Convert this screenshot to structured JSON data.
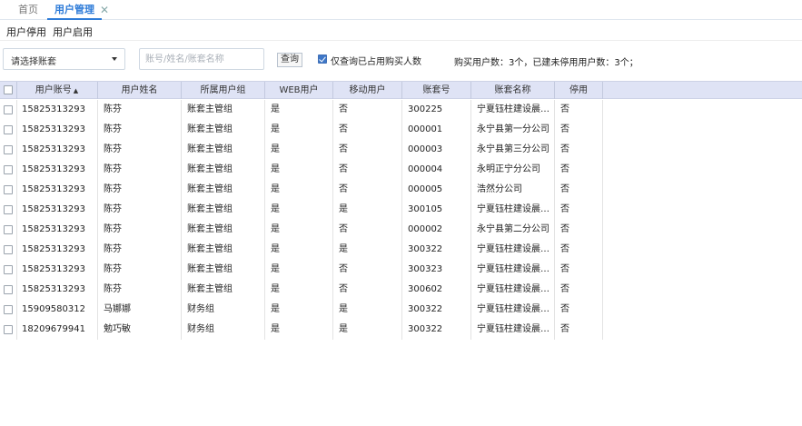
{
  "tabs": {
    "home": "首页",
    "active": "用户管理",
    "close": "✕"
  },
  "actions": {
    "stop": "用户停用",
    "start": "用户启用"
  },
  "filters": {
    "account_select": "请选择账套",
    "search_placeholder": "账号/姓名/账套名称",
    "query_button": "查询",
    "only_purchased_checked": true,
    "only_purchased_label": "仅查询已占用购买人数",
    "summary": "购买用户数：3个，已建未停用用户数：3个；"
  },
  "table": {
    "columns": [
      "用户账号",
      "用户姓名",
      "所属用户组",
      "WEB用户",
      "移动用户",
      "账套号",
      "账套名称",
      "停用"
    ],
    "sort_icon": "▲",
    "rows": [
      [
        "15825313293",
        "陈芬",
        "账套主管组",
        "是",
        "否",
        "300225",
        "宁夏钰柱建设晨…",
        "否"
      ],
      [
        "15825313293",
        "陈芬",
        "账套主管组",
        "是",
        "否",
        "000001",
        "永宁县第一分公司",
        "否"
      ],
      [
        "15825313293",
        "陈芬",
        "账套主管组",
        "是",
        "否",
        "000003",
        "永宁县第三分公司",
        "否"
      ],
      [
        "15825313293",
        "陈芬",
        "账套主管组",
        "是",
        "否",
        "000004",
        "永明正宁分公司",
        "否"
      ],
      [
        "15825313293",
        "陈芬",
        "账套主管组",
        "是",
        "否",
        "000005",
        "浩然分公司",
        "否"
      ],
      [
        "15825313293",
        "陈芬",
        "账套主管组",
        "是",
        "是",
        "300105",
        "宁夏钰柱建设晨…",
        "否"
      ],
      [
        "15825313293",
        "陈芬",
        "账套主管组",
        "是",
        "否",
        "000002",
        "永宁县第二分公司",
        "否"
      ],
      [
        "15825313293",
        "陈芬",
        "账套主管组",
        "是",
        "是",
        "300322",
        "宁夏钰柱建设晨…",
        "否"
      ],
      [
        "15825313293",
        "陈芬",
        "账套主管组",
        "是",
        "否",
        "300323",
        "宁夏钰柱建设晨…",
        "否"
      ],
      [
        "15825313293",
        "陈芬",
        "账套主管组",
        "是",
        "否",
        "300602",
        "宁夏钰柱建设晨…",
        "否"
      ],
      [
        "15909580312",
        "马娜娜",
        "财务组",
        "是",
        "是",
        "300322",
        "宁夏钰柱建设晨…",
        "否"
      ],
      [
        "18209679941",
        "勉巧敏",
        "财务组",
        "是",
        "是",
        "300322",
        "宁夏钰柱建设晨…",
        "否"
      ]
    ]
  }
}
